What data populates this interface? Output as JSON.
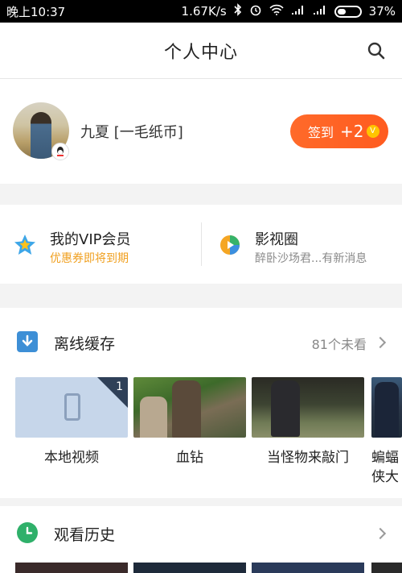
{
  "status_bar": {
    "time": "晚上10:37",
    "net_speed": "1.67K/s",
    "battery": "37%"
  },
  "header": {
    "title": "个人中心"
  },
  "profile": {
    "username": "九夏 [一毛纸币]",
    "signin_label": "签到",
    "signin_points": "+2",
    "coin_symbol": "V"
  },
  "vip": {
    "title": "我的VIP会员",
    "subtitle": "优惠券即将到期",
    "subtitle_color": "#f0a020"
  },
  "circle": {
    "title": "影视圈",
    "subtitle": "醉卧沙场君...有新消息",
    "subtitle_color": "#8a8a8a"
  },
  "offline_cache": {
    "title": "离线缓存",
    "more": "81个未看",
    "items": [
      {
        "caption": "本地视频",
        "badge": "1"
      },
      {
        "caption": "血钻"
      },
      {
        "caption": "当怪物来敲门"
      },
      {
        "caption": "蝙蝠侠大战超人：正义"
      }
    ]
  },
  "history": {
    "title": "观看历史"
  },
  "colors": {
    "accent_orange": "#ff5f22",
    "icon_blue": "#3d8fd6",
    "icon_green": "#2fb06a"
  }
}
